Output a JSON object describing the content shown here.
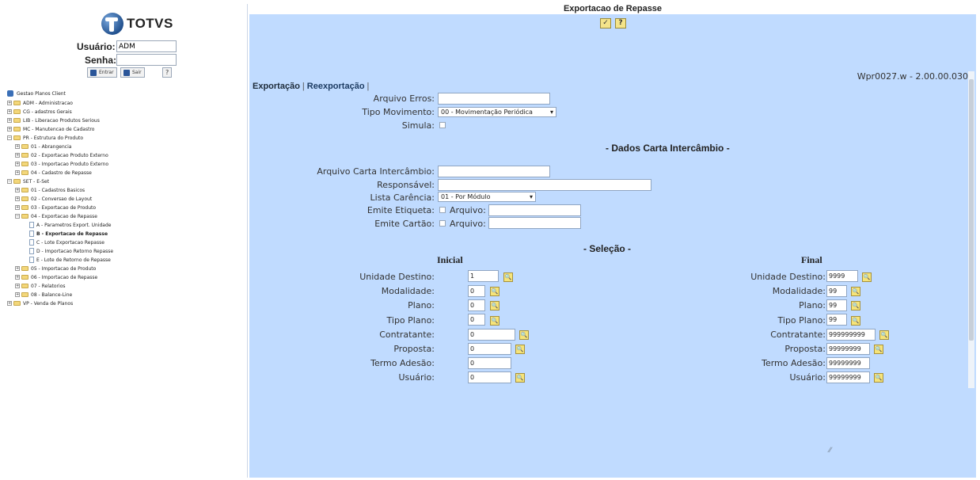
{
  "app": {
    "brand": "TOTVS",
    "screen_title": "Exportacao de Repasse",
    "version": "Wpr0027.w - 2.00.00.030"
  },
  "login": {
    "user_label": "Usuário:",
    "user_value": "ADM",
    "password_label": "Senha:",
    "password_value": "",
    "enter_label": "Entrar",
    "exit_label": "Sair",
    "help_label": "?"
  },
  "toolbar": {
    "confirm_label": "✓",
    "help_label": "?"
  },
  "tree": {
    "root": "Gestao Planos Client",
    "items": [
      {
        "label": "ADM - Administracao"
      },
      {
        "label": "CG - adastros Gerais"
      },
      {
        "label": "LIB - Liberacao Produtos Serious"
      },
      {
        "label": "MC - Manutencao de Cadastro"
      },
      {
        "label": "PR - Estrutura do Produto"
      },
      {
        "label": "01 - Abrangencia"
      },
      {
        "label": "02 - Exportacao Produto Externo"
      },
      {
        "label": "03 - Importacao Produto Externo"
      },
      {
        "label": "04 - Cadastro de Repasse"
      },
      {
        "label": "SET - E-Set"
      },
      {
        "label": "01 - Cadastros Basicos"
      },
      {
        "label": "02 - Conversao de Layout"
      },
      {
        "label": "03 - Exportacao de Produto"
      },
      {
        "label": "04 - Exportacao de Repasse"
      },
      {
        "label": "A - Parametros Export. Unidade"
      },
      {
        "label": "B - Exportacao de Repasse"
      },
      {
        "label": "C - Lote Exportacao Repasse"
      },
      {
        "label": "D - Importacao Retorno Repasse"
      },
      {
        "label": "E - Lote de Retorno de Repasse"
      },
      {
        "label": "05 - Importacao de Produto"
      },
      {
        "label": "06 - Importacao de Repasse"
      },
      {
        "label": "07 - Relatorios"
      },
      {
        "label": "08 - Balance-Line"
      },
      {
        "label": "VP - Venda de Planos"
      }
    ]
  },
  "tabs": [
    {
      "label": "Exportação"
    },
    {
      "label": "Reexportação"
    }
  ],
  "form": {
    "arquivo_erros_label": "Arquivo Erros:",
    "arquivo_erros_value": "",
    "tipo_movimento_label": "Tipo Movimento:",
    "tipo_movimento_value": "00 - Movimentação Periódica",
    "simula_label": "Simula:",
    "dados_header": "- Dados Carta Intercâmbio -",
    "arquivo_carta_label": "Arquivo Carta Intercâmbio:",
    "arquivo_carta_value": "",
    "responsavel_label": "Responsável:",
    "responsavel_value": "",
    "lista_carencia_label": "Lista Carência:",
    "lista_carencia_value": "01 - Por Módulo",
    "emite_etiqueta_label": "Emite Etiqueta:",
    "emite_cartao_label": "Emite Cartão:",
    "arquivo_label": "Arquivo:",
    "selecao_header": "- Seleção -",
    "inicial_header": "Inicial",
    "final_header": "Final"
  },
  "selection": {
    "unidade_destino": {
      "label": "Unidade Destino:",
      "ini": "1",
      "fim": "9999"
    },
    "modalidade": {
      "label": "Modalidade:",
      "ini": "0",
      "fim": "99"
    },
    "plano": {
      "label": "Plano:",
      "ini": "0",
      "fim": "99"
    },
    "tipo_plano": {
      "label": "Tipo Plano:",
      "ini": "0",
      "fim": "99"
    },
    "contratante": {
      "label": "Contratante:",
      "ini": "0",
      "fim": "999999999"
    },
    "proposta": {
      "label": "Proposta:",
      "ini": "0",
      "fim": "99999999"
    },
    "termo_adesao": {
      "label": "Termo Adesão:",
      "ini": "0",
      "fim": "99999999"
    },
    "usuario": {
      "label": "Usuário:",
      "ini": "0",
      "fim": "99999999"
    }
  },
  "colors": {
    "panel_bg": "#c0dbff",
    "button_yellow": "#f4e48a",
    "tree_folder": "#f3d77a"
  },
  "icons": {
    "search": "magnifier-icon",
    "confirm": "check-icon",
    "folder": "folder-icon",
    "document": "document-icon"
  }
}
